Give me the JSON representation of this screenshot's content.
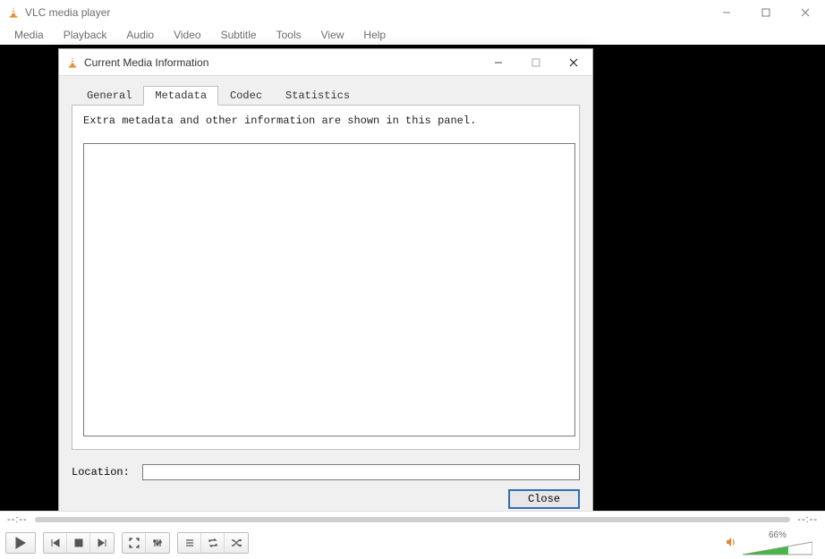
{
  "app": {
    "title": "VLC media player"
  },
  "menu": {
    "items": [
      "Media",
      "Playback",
      "Audio",
      "Video",
      "Subtitle",
      "Tools",
      "View",
      "Help"
    ]
  },
  "dialog": {
    "title": "Current Media Information",
    "tabs": {
      "general": "General",
      "metadata": "Metadata",
      "codec": "Codec",
      "statistics": "Statistics"
    },
    "hint": "Extra metadata and other information are shown in this panel.",
    "location_label": "Location:",
    "location_value": "",
    "close": "Close"
  },
  "player": {
    "time_elapsed": "--:--",
    "time_total": "--:--",
    "volume_pct": "66%"
  }
}
